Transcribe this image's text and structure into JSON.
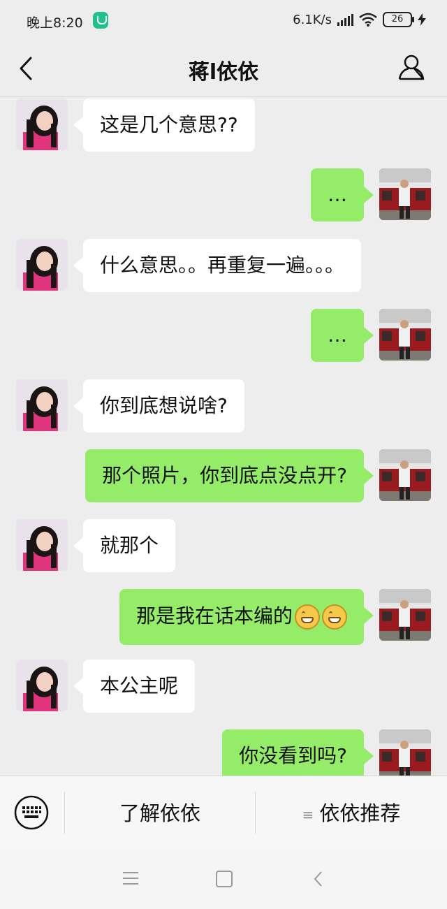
{
  "status": {
    "time": "晚上8:20",
    "speed": "6.1K/s",
    "battery": "26"
  },
  "header": {
    "title": "蒋l依依"
  },
  "messages": [
    {
      "side": "in",
      "text": "这是几个意思??"
    },
    {
      "side": "out",
      "text": "…"
    },
    {
      "side": "in",
      "text": "什么意思。。再重复一遍。。。"
    },
    {
      "side": "out",
      "text": "…"
    },
    {
      "side": "in",
      "text": "你到底想说啥?"
    },
    {
      "side": "out",
      "text": "那个照片，你到底点没点开?"
    },
    {
      "side": "in",
      "text": "就那个"
    },
    {
      "side": "out",
      "text": "那是我在话本编的",
      "emoji": "grin-emoji"
    },
    {
      "side": "in",
      "text": "本公主呢"
    },
    {
      "side": "out",
      "text": "你没看到吗?"
    }
  ],
  "bottom": {
    "menu1": "了解依依",
    "menu2": "依依推荐"
  },
  "colors": {
    "incoming": "#ffffff",
    "outgoing": "#95ec69",
    "background": "#ededed"
  }
}
